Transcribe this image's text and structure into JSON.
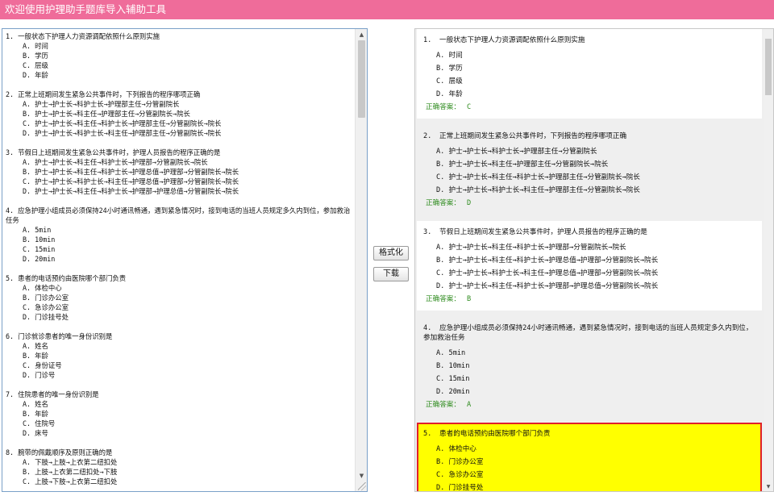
{
  "app": {
    "title": "欢迎使用护理助手题库导入辅助工具"
  },
  "left_lines": [
    {
      "t": "1. 一般状态下护理人力资源调配依照什么原则实施",
      "k": "q"
    },
    {
      "t": "A. 时间",
      "k": "o"
    },
    {
      "t": "B. 学历",
      "k": "o"
    },
    {
      "t": "C. 层级",
      "k": "o"
    },
    {
      "t": "D. 年龄",
      "k": "o"
    },
    {
      "t": "",
      "k": "g"
    },
    {
      "t": "2. 正常上班期间发生紧急公共事件时，下列报告的程序哪项正确",
      "k": "q"
    },
    {
      "t": "A. 护士→护士长→科护士长→护理部主任→分管副院长",
      "k": "o"
    },
    {
      "t": "B. 护士→护士长→科主任→护理部主任→分管副院长→院长",
      "k": "o"
    },
    {
      "t": "C. 护士→护士长→科主任→科护士长→护理部主任→分管副院长→院长",
      "k": "o"
    },
    {
      "t": "D. 护士→护士长→科护士长→科主任→护理部主任→分管副院长→院长",
      "k": "o"
    },
    {
      "t": "",
      "k": "g"
    },
    {
      "t": "3. 节假日上班期间发生紧急公共事件时，护理人员报告的程序正确的是",
      "k": "q"
    },
    {
      "t": "A. 护士→护士长→科主任→科护士长→护理部→分管副院长→院长",
      "k": "o"
    },
    {
      "t": "B. 护士→护士长→科主任→科护士长→护理总值→护理部→分管副院长→院长",
      "k": "o"
    },
    {
      "t": "C. 护士→护士长→科护士长→科主任→护理总值→护理部→分管副院长→院长",
      "k": "o"
    },
    {
      "t": "D. 护士→护士长→科主任→科护士长→护理部→护理总值→分管副院长→院长",
      "k": "o"
    },
    {
      "t": "",
      "k": "g"
    },
    {
      "t": "4. 应急护理小组成员必须保持24小时通讯畅通，遇到紧急情况时，接到电话的当班人员规定多久内到位，参加救治任务",
      "k": "q"
    },
    {
      "t": "A. 5min",
      "k": "o"
    },
    {
      "t": "B. 10min",
      "k": "o"
    },
    {
      "t": "C. 15min",
      "k": "o"
    },
    {
      "t": "D. 20min",
      "k": "o"
    },
    {
      "t": "",
      "k": "g"
    },
    {
      "t": "5. 患者的电话预约由医院哪个部门负责",
      "k": "q"
    },
    {
      "t": "A. 体检中心",
      "k": "o"
    },
    {
      "t": "B. 门诊办公室",
      "k": "o"
    },
    {
      "t": "C. 急诊办公室",
      "k": "o"
    },
    {
      "t": "D. 门诊挂号处",
      "k": "o"
    },
    {
      "t": "",
      "k": "g"
    },
    {
      "t": "6. 门诊就诊患者的唯一身份识别是",
      "k": "q"
    },
    {
      "t": "A. 姓名",
      "k": "o"
    },
    {
      "t": "B. 年龄",
      "k": "o"
    },
    {
      "t": "C. 身份证号",
      "k": "o"
    },
    {
      "t": "D. 门诊号",
      "k": "o"
    },
    {
      "t": "",
      "k": "g"
    },
    {
      "t": "7. 住院患者的唯一身份识别是",
      "k": "q"
    },
    {
      "t": "A. 姓名",
      "k": "o"
    },
    {
      "t": "B. 年龄",
      "k": "o"
    },
    {
      "t": "C. 住院号",
      "k": "o"
    },
    {
      "t": "D. 床号",
      "k": "o"
    },
    {
      "t": "",
      "k": "g"
    },
    {
      "t": "8. 腕带的佩戴顺序及原则正确的是",
      "k": "q"
    },
    {
      "t": "A. 下肢→上肢→上衣第二纽扣处",
      "k": "o"
    },
    {
      "t": "B. 上肢→上衣第二纽扣处→下肢",
      "k": "o"
    },
    {
      "t": "C. 上肢→下肢→上衣第二纽扣处",
      "k": "o"
    }
  ],
  "buttons": {
    "format": "格式化",
    "download": "下载"
  },
  "answer_label": "正确答案：",
  "cards": [
    {
      "num": "1.",
      "q": "一般状态下护理人力资源调配依照什么原则实施",
      "options": [
        "A. 时间",
        "B. 学历",
        "C. 层级",
        "D. 年龄"
      ],
      "answer": "C",
      "style": "white"
    },
    {
      "num": "2.",
      "q": "正常上班期间发生紧急公共事件时，下列报告的程序哪项正确",
      "options": [
        "A. 护士→护士长→科护士长→护理部主任→分管副院长",
        "B. 护士→护士长→科主任→护理部主任→分管副院长→院长",
        "C. 护士→护士长→科主任→科护士长→护理部主任→分管副院长→院长",
        "D. 护士→护士长→科护士长→科主任→护理部主任→分管副院长→院长"
      ],
      "answer": "D",
      "style": "grey"
    },
    {
      "num": "3.",
      "q": "节假日上班期间发生紧急公共事件时，护理人员报告的程序正确的是",
      "options": [
        "A. 护士→护士长→科主任→科护士长→护理部→分管副院长→院长",
        "B. 护士→护士长→科主任→科护士长→护理总值→护理部→分管副院长→院长",
        "C. 护士→护士长→科护士长→科主任→护理总值→护理部→分管副院长→院长",
        "D. 护士→护士长→科主任→科护士长→护理部→护理总值→分管副院长→院长"
      ],
      "answer": "B",
      "style": "white"
    },
    {
      "num": "4.",
      "q": "应急护理小组成员必须保持24小时通讯畅通，遇到紧急情况时，接到电话的当班人员规定多久内到位，参加救治任务",
      "options": [
        "A. 5min",
        "B. 10min",
        "C. 15min",
        "D. 20min"
      ],
      "answer": "A",
      "style": "grey"
    },
    {
      "num": "5.",
      "q": "患者的电话预约由医院哪个部门负责",
      "options": [
        "A. 体检中心",
        "B. 门诊办公室",
        "C. 急诊办公室",
        "D. 门诊挂号处"
      ],
      "answer": "",
      "style": "hl"
    }
  ],
  "icons": {
    "scroll_up": "scroll-up-arrow-icon",
    "scroll_down": "scroll-down-arrow-icon",
    "grip": "resize-grip-icon"
  }
}
